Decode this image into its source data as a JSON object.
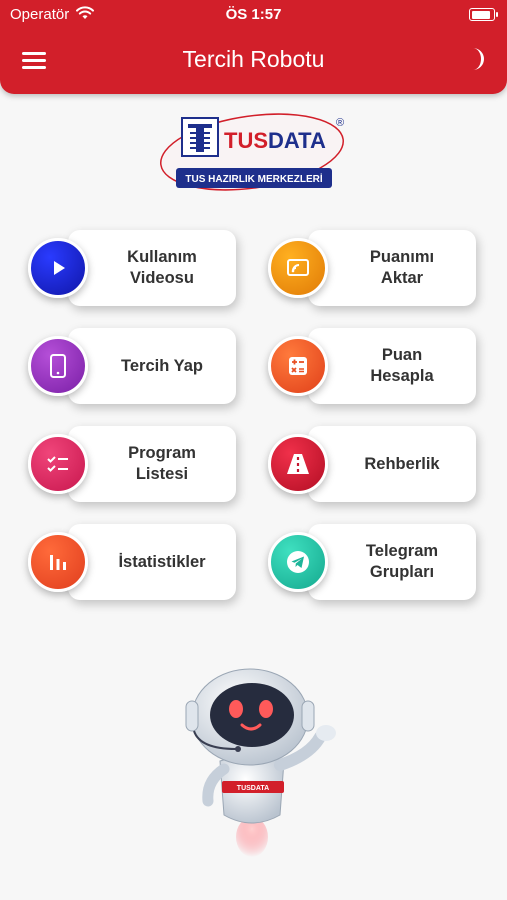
{
  "status_bar": {
    "carrier": "Operatör",
    "time": "ÖS 1:57",
    "battery_level": 0.9
  },
  "header": {
    "title": "Tercih Robotu",
    "menu_icon": "hamburger-menu-icon",
    "theme_icon": "moon-icon"
  },
  "logo": {
    "brand": "TUSDATA",
    "tagline": "TUS HAZIRLIK MERKEZLERİ",
    "registered": "®"
  },
  "menu": [
    {
      "id": "kullanim-videosu",
      "label": "Kullanım\nVideosu",
      "icon": "play-icon",
      "color_from": "#2a3bff",
      "color_to": "#1016a8"
    },
    {
      "id": "puanimi-aktar",
      "label": "Puanımı\nAktar",
      "icon": "transfer-icon",
      "color_from": "#ffb020",
      "color_to": "#e07a06"
    },
    {
      "id": "tercih-yap",
      "label": "Tercih Yap",
      "icon": "phone-icon",
      "color_from": "#b54fd8",
      "color_to": "#7a1fa6"
    },
    {
      "id": "puan-hesapla",
      "label": "Puan\nHesapla",
      "icon": "calculator-icon",
      "color_from": "#ff7a3c",
      "color_to": "#e0401a"
    },
    {
      "id": "program-listesi",
      "label": "Program\nListesi",
      "icon": "checklist-icon",
      "color_from": "#f0457a",
      "color_to": "#c8174e"
    },
    {
      "id": "rehberlik",
      "label": "Rehberlik",
      "icon": "road-icon",
      "color_from": "#f0304a",
      "color_to": "#b30e24"
    },
    {
      "id": "istatistikler",
      "label": "İstatistikler",
      "icon": "bar-chart-icon",
      "color_from": "#ff6a3a",
      "color_to": "#e03e1e"
    },
    {
      "id": "telegram-gruplari",
      "label": "Telegram\nGrupları",
      "icon": "telegram-icon",
      "color_from": "#3fe0c0",
      "color_to": "#14a88e"
    }
  ],
  "robot": {
    "chest_text": "TUSDATA",
    "icon": "robot-mascot-icon"
  }
}
